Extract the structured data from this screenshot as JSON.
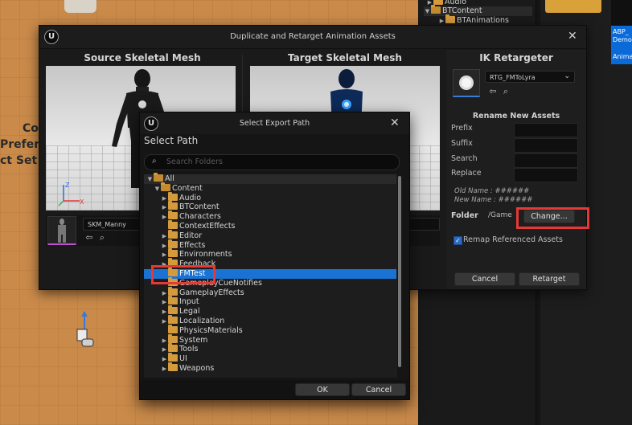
{
  "background": {
    "content_tree": [
      {
        "label": "Audio",
        "indent": 1,
        "open": false,
        "selected": false
      },
      {
        "label": "BTContent",
        "indent": 1,
        "open": true,
        "selected": true
      },
      {
        "label": "BTAnimations",
        "indent": 2,
        "open": false,
        "selected": false
      }
    ],
    "side_text": [
      "Co",
      "Prefere",
      "ct Set"
    ],
    "asset_thumb_label_1": "ABP_",
    "asset_thumb_label_2": "Demo",
    "asset_thumb_label_3": "Animat"
  },
  "dialog": {
    "title": "Duplicate and Retarget Animation Assets",
    "close_icon": "close-icon",
    "source_header": "Source Skeletal Mesh",
    "target_header": "Target Skeletal Mesh",
    "source_mesh": "SKM_Manny",
    "ik_header": "IK Retargeter",
    "ik_asset": "RTG_FMToLyra",
    "rename_header": "Rename New Assets",
    "prefix_label": "Prefix",
    "suffix_label": "Suffix",
    "search_label": "Search",
    "replace_label": "Replace",
    "old_name": "Old Name : ######",
    "new_name": "New Name : ######",
    "folder_label": "Folder",
    "folder_value": "/Game",
    "change_button": "Change...",
    "remap_label": "Remap Referenced Assets",
    "remap_checked": true,
    "cancel_button": "Cancel",
    "retarget_button": "Retarget"
  },
  "export": {
    "window_title": "Select Export Path",
    "heading": "Select Path",
    "search_placeholder": "Search Folders",
    "tree": [
      {
        "label": "All",
        "indent": 0,
        "expand": "open",
        "selected": false,
        "first": true
      },
      {
        "label": "Content",
        "indent": 1,
        "expand": "open",
        "selected": false
      },
      {
        "label": "Audio",
        "indent": 2,
        "expand": "closed",
        "selected": false
      },
      {
        "label": "BTContent",
        "indent": 2,
        "expand": "closed",
        "selected": false
      },
      {
        "label": "Characters",
        "indent": 2,
        "expand": "closed",
        "selected": false
      },
      {
        "label": "ContextEffects",
        "indent": 2,
        "expand": "none",
        "selected": false
      },
      {
        "label": "Editor",
        "indent": 2,
        "expand": "closed",
        "selected": false
      },
      {
        "label": "Effects",
        "indent": 2,
        "expand": "closed",
        "selected": false
      },
      {
        "label": "Environments",
        "indent": 2,
        "expand": "closed",
        "selected": false
      },
      {
        "label": "Feedback",
        "indent": 2,
        "expand": "closed",
        "selected": false
      },
      {
        "label": "FMTest",
        "indent": 2,
        "expand": "none",
        "selected": true
      },
      {
        "label": "GameplayCueNotifies",
        "indent": 2,
        "expand": "none",
        "selected": false
      },
      {
        "label": "GameplayEffects",
        "indent": 2,
        "expand": "closed",
        "selected": false
      },
      {
        "label": "Input",
        "indent": 2,
        "expand": "closed",
        "selected": false
      },
      {
        "label": "Legal",
        "indent": 2,
        "expand": "closed",
        "selected": false
      },
      {
        "label": "Localization",
        "indent": 2,
        "expand": "closed",
        "selected": false
      },
      {
        "label": "PhysicsMaterials",
        "indent": 2,
        "expand": "none",
        "selected": false
      },
      {
        "label": "System",
        "indent": 2,
        "expand": "closed",
        "selected": false
      },
      {
        "label": "Tools",
        "indent": 2,
        "expand": "closed",
        "selected": false
      },
      {
        "label": "UI",
        "indent": 2,
        "expand": "closed",
        "selected": false
      },
      {
        "label": "Weapons",
        "indent": 2,
        "expand": "closed",
        "selected": false
      }
    ],
    "ok_button": "OK",
    "cancel_button": "Cancel"
  },
  "colors": {
    "selection": "#1a73d4",
    "folder": "#d59a3c",
    "highlight_box": "#e53935",
    "accent_underline": "#c04fd1"
  }
}
